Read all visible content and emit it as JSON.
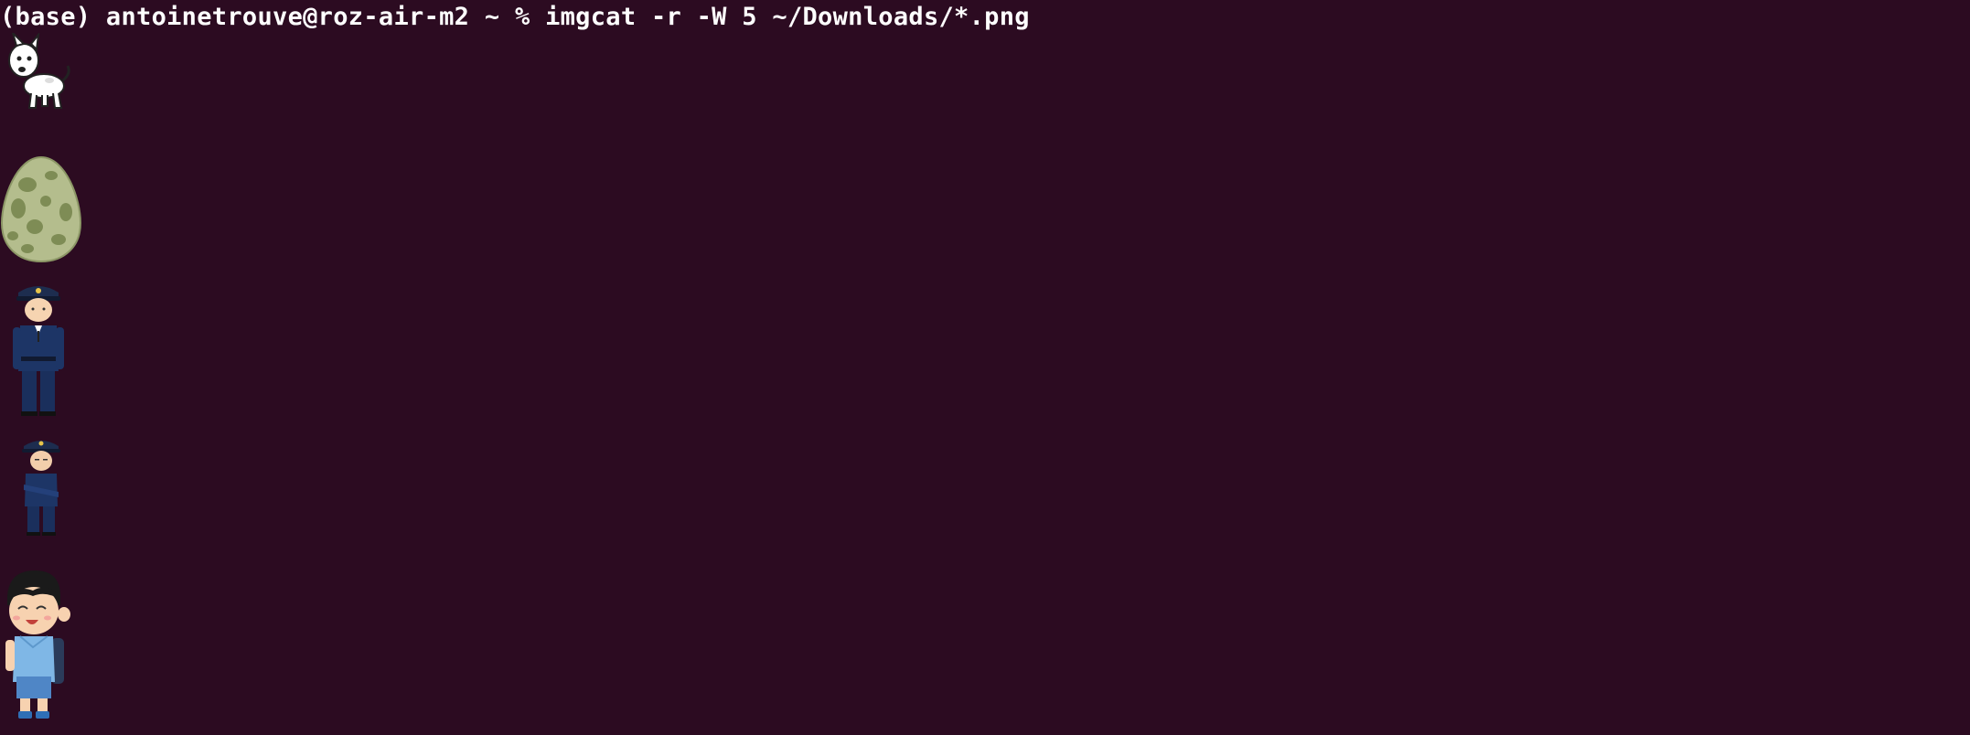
{
  "terminal": {
    "env": "(base)",
    "user_host": "antoinetrouve@roz-air-m2",
    "cwd": "~",
    "prompt_symbol": "%",
    "command": "imgcat -r -W 5 ~/Downloads/*.png",
    "background_color": "#2c0b21",
    "text_color": "#ffffff"
  },
  "output_images": [
    {
      "name": "dog-image",
      "icon": "cartoon-dog"
    },
    {
      "name": "egg-image",
      "icon": "spotted-green-egg"
    },
    {
      "name": "police-officer-image",
      "icon": "standing-police-officer"
    },
    {
      "name": "police-officer-arms-crossed-image",
      "icon": "police-officer-arms-crossed"
    },
    {
      "name": "schoolchild-image",
      "icon": "smiling-schoolchild-with-backpack"
    }
  ]
}
